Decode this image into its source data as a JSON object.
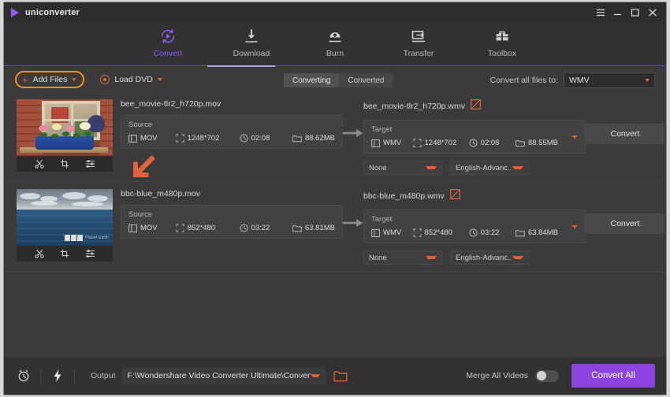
{
  "window": {
    "app_name": "uniconverter",
    "controls": [
      {
        "name": "menu",
        "glyph": "☰"
      },
      {
        "name": "minimize",
        "glyph": "–"
      },
      {
        "name": "maximize",
        "glyph": "□"
      },
      {
        "name": "close",
        "glyph": "✕"
      }
    ]
  },
  "nav": {
    "items": [
      {
        "label": "Convert",
        "icon": "convert-icon",
        "active": true
      },
      {
        "label": "Download",
        "icon": "download-icon",
        "active": false
      },
      {
        "label": "Burn",
        "icon": "burn-icon",
        "active": false
      },
      {
        "label": "Transfer",
        "icon": "transfer-icon",
        "active": false
      },
      {
        "label": "Toolbox",
        "icon": "toolbox-icon",
        "active": false
      }
    ]
  },
  "toolbar": {
    "add_files_label": "Add Files",
    "load_dvd_label": "Load DVD",
    "tabs": [
      {
        "label": "Converting",
        "active": true
      },
      {
        "label": "Converted",
        "active": false
      }
    ],
    "convert_all_to_label": "Convert all files to:",
    "convert_all_to_value": "WMV"
  },
  "files": [
    {
      "source_name": "bee_movie-tlr2_h720p.mov",
      "target_name": "bee_movie-tlr2_h720p.wmv",
      "source": {
        "title": "Source",
        "format": "MOV",
        "resolution": "1248*702",
        "duration": "02:08",
        "size": "88.62MB"
      },
      "target": {
        "title": "Target",
        "format": "WMV",
        "resolution": "1248*702",
        "duration": "02:08",
        "size": "88.55MB"
      },
      "subtitle": "None",
      "audio": "English-Advanc...",
      "convert_label": "Convert",
      "thumb_tools": [
        "trim-icon",
        "crop-icon",
        "effect-icon"
      ]
    },
    {
      "source_name": "bbc-blue_m480p.mov",
      "target_name": "bbc-blue_m480p.wmv",
      "source": {
        "title": "Source",
        "format": "MOV",
        "resolution": "852*480",
        "duration": "03:22",
        "size": "63.81MB"
      },
      "target": {
        "title": "Target",
        "format": "WMV",
        "resolution": "852*480",
        "duration": "03:22",
        "size": "63.84MB"
      },
      "subtitle": "None",
      "audio": "English-Advanc...",
      "convert_label": "Convert",
      "thumb_tools": [
        "trim-icon",
        "crop-icon",
        "effect-icon"
      ]
    }
  ],
  "bottom": {
    "output_label": "Output",
    "output_path": "F:\\Wondershare Video Converter Ultimate\\Converted",
    "merge_label": "Merge All Videos",
    "merge_on": false,
    "convert_all_label": "Convert All"
  },
  "colors": {
    "accent_purple": "#8b5cf6",
    "accent_orange": "#e2613a",
    "highlight_ring": "#f0901e",
    "panel": "#3b3b3b",
    "chrome": "#323232"
  }
}
